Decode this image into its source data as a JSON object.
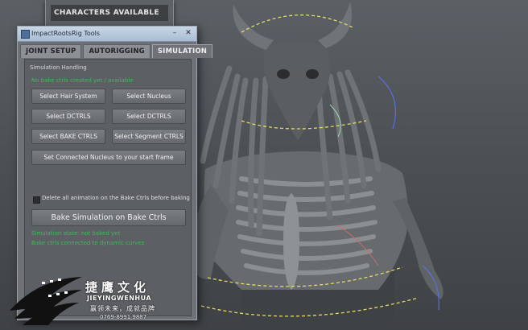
{
  "background_window": {
    "title": "CHARACTERS AVAILABLE"
  },
  "window": {
    "title": "ImpactRootsRig Tools",
    "controls": {
      "minimize": "–",
      "close": "✕"
    },
    "tabs": [
      {
        "label": "JOINT SETUP",
        "active": false
      },
      {
        "label": "AUTORIGGING",
        "active": false
      },
      {
        "label": "SIMULATION",
        "active": true
      }
    ],
    "section_title": "Simulation Handling",
    "status_top": "No bake ctrls created yet / available",
    "buttons": {
      "select_hair_system": "Select Hair System",
      "select_nucleus": "Select Nucleus",
      "select_dctrls_left": "Select DCTRLS",
      "select_dctrls_right": "Select DCTRLS",
      "select_bake_ctrls": "Select BAKE CTRLS",
      "select_segment_ctrls": "Select Segment CTRLS",
      "set_connected_nucleus": "Set Connected Nucleus to your start frame",
      "bake_simulation": "Bake Simulation on Bake Ctrls"
    },
    "checkbox": {
      "label": "Delete all animation on the Bake Ctrls before baking",
      "checked": false
    },
    "status_bottom": [
      "Simulation state: not baked yet",
      "Bake ctrls connected to dynamic curves"
    ]
  },
  "logo": {
    "chinese": "捷鹰文化",
    "english": "JIEYINGWENHUA",
    "slogan": "赢领未来，成就品牌",
    "phone": "0769-8991 9887"
  },
  "colors": {
    "status_green": "#3fb85a",
    "panel": "#5c6064",
    "tab_active": "#6e7276",
    "viewport": "#4d5155"
  }
}
